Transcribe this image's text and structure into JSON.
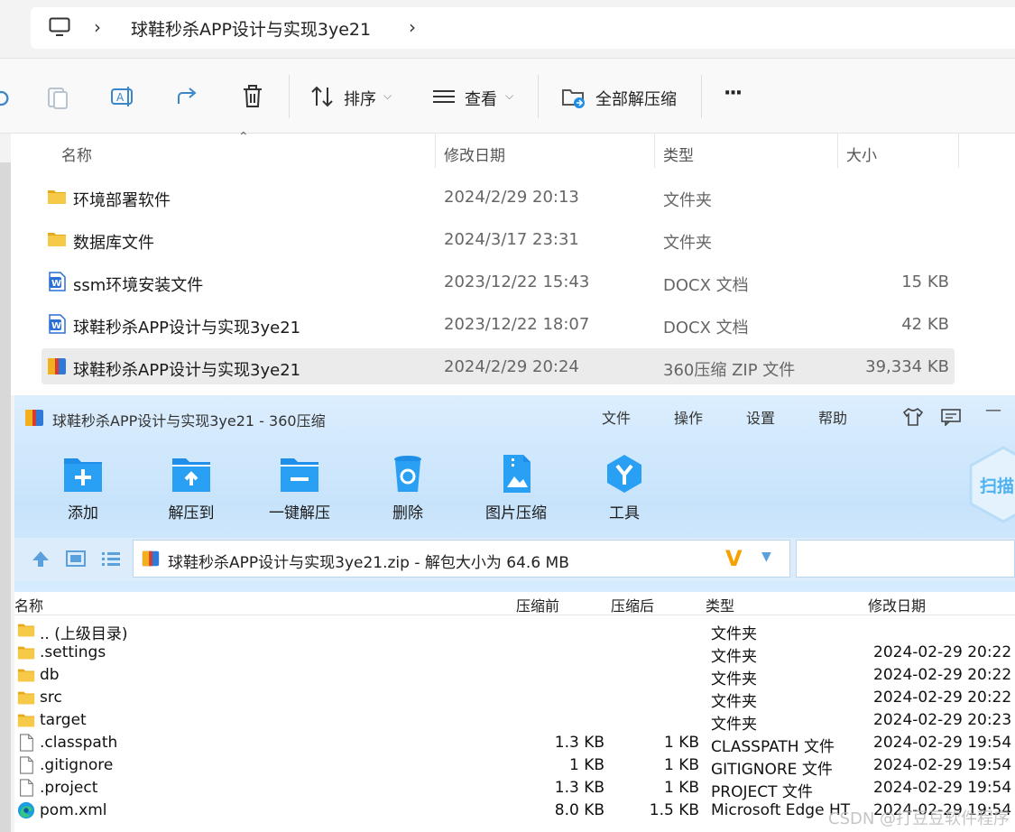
{
  "explorer": {
    "breadcrumb": {
      "current": "球鞋秒杀APP设计与实现3ye21",
      "computer_icon": "monitor-icon",
      "separator": "›"
    },
    "commands": {
      "sort_label": "排序",
      "view_label": "查看",
      "extract_all_label": "全部解压缩",
      "more_label": "···"
    },
    "columns": {
      "name": "名称",
      "modified": "修改日期",
      "type": "类型",
      "size": "大小"
    },
    "files": [
      {
        "name": "环境部署软件",
        "modified": "2024/2/29 20:13",
        "type": "文件夹",
        "size": "",
        "icon": "folder-icon"
      },
      {
        "name": "数据库文件",
        "modified": "2024/3/17 23:31",
        "type": "文件夹",
        "size": "",
        "icon": "folder-icon"
      },
      {
        "name": "ssm环境安装文件",
        "modified": "2023/12/22 15:43",
        "type": "DOCX 文档",
        "size": "15 KB",
        "icon": "word-doc-icon"
      },
      {
        "name": "球鞋秒杀APP设计与实现3ye21",
        "modified": "2023/12/22 18:07",
        "type": "DOCX 文档",
        "size": "42 KB",
        "icon": "word-doc-icon"
      },
      {
        "name": "球鞋秒杀APP设计与实现3ye21",
        "modified": "2024/2/29 20:24",
        "type": "360压缩 ZIP 文件",
        "size": "39,334 KB",
        "icon": "zip-archive-icon",
        "selected": true
      }
    ]
  },
  "archiver": {
    "title": "球鞋秒杀APP设计与实现3ye21 - 360压缩",
    "menu": [
      "文件",
      "操作",
      "设置",
      "帮助"
    ],
    "minimize_label": "—",
    "scan_label": "扫描",
    "tools": [
      {
        "label": "添加",
        "icon": "add-icon"
      },
      {
        "label": "解压到",
        "icon": "extract-to-icon"
      },
      {
        "label": "一键解压",
        "icon": "one-click-extract-icon"
      },
      {
        "label": "删除",
        "icon": "recycle-delete-icon"
      },
      {
        "label": "图片压缩",
        "icon": "image-compress-icon"
      },
      {
        "label": "工具",
        "icon": "tools-icon"
      }
    ],
    "path": "球鞋秒杀APP设计与实现3ye21.zip - 解包大小为 64.6 MB",
    "path_logo": "V",
    "columns": {
      "name": "名称",
      "before": "压缩前",
      "after": "压缩后",
      "type": "类型",
      "modified": "修改日期"
    },
    "entries": [
      {
        "name": ".. (上级目录)",
        "before": "",
        "after": "",
        "type": "文件夹",
        "modified": "",
        "icon": "folder-icon"
      },
      {
        "name": ".settings",
        "before": "",
        "after": "",
        "type": "文件夹",
        "modified": "2024-02-29 20:22",
        "icon": "folder-icon"
      },
      {
        "name": "db",
        "before": "",
        "after": "",
        "type": "文件夹",
        "modified": "2024-02-29 20:22",
        "icon": "folder-icon"
      },
      {
        "name": "src",
        "before": "",
        "after": "",
        "type": "文件夹",
        "modified": "2024-02-29 20:22",
        "icon": "folder-icon"
      },
      {
        "name": "target",
        "before": "",
        "after": "",
        "type": "文件夹",
        "modified": "2024-02-29 20:23",
        "icon": "folder-icon"
      },
      {
        "name": ".classpath",
        "before": "1.3 KB",
        "after": "1 KB",
        "type": "CLASSPATH 文件",
        "modified": "2024-02-29 19:54",
        "icon": "file-icon"
      },
      {
        "name": ".gitignore",
        "before": "1 KB",
        "after": "1 KB",
        "type": "GITIGNORE 文件",
        "modified": "2024-02-29 19:54",
        "icon": "file-icon"
      },
      {
        "name": ".project",
        "before": "1.3 KB",
        "after": "1 KB",
        "type": "PROJECT 文件",
        "modified": "2024-02-29 19:54",
        "icon": "file-icon"
      },
      {
        "name": "pom.xml",
        "before": "8.0 KB",
        "after": "1.5 KB",
        "type": "Microsoft Edge HT",
        "modified": "2024-02-29 19:54",
        "icon": "edge-icon"
      }
    ]
  },
  "watermark": "CSDN @打豆豆软件程序",
  "colors": {
    "folder": "#f7c948",
    "accent_blue": "#1e8ee8",
    "selected_row": "#ebebeb",
    "zip_header": "#c7e3fb"
  }
}
